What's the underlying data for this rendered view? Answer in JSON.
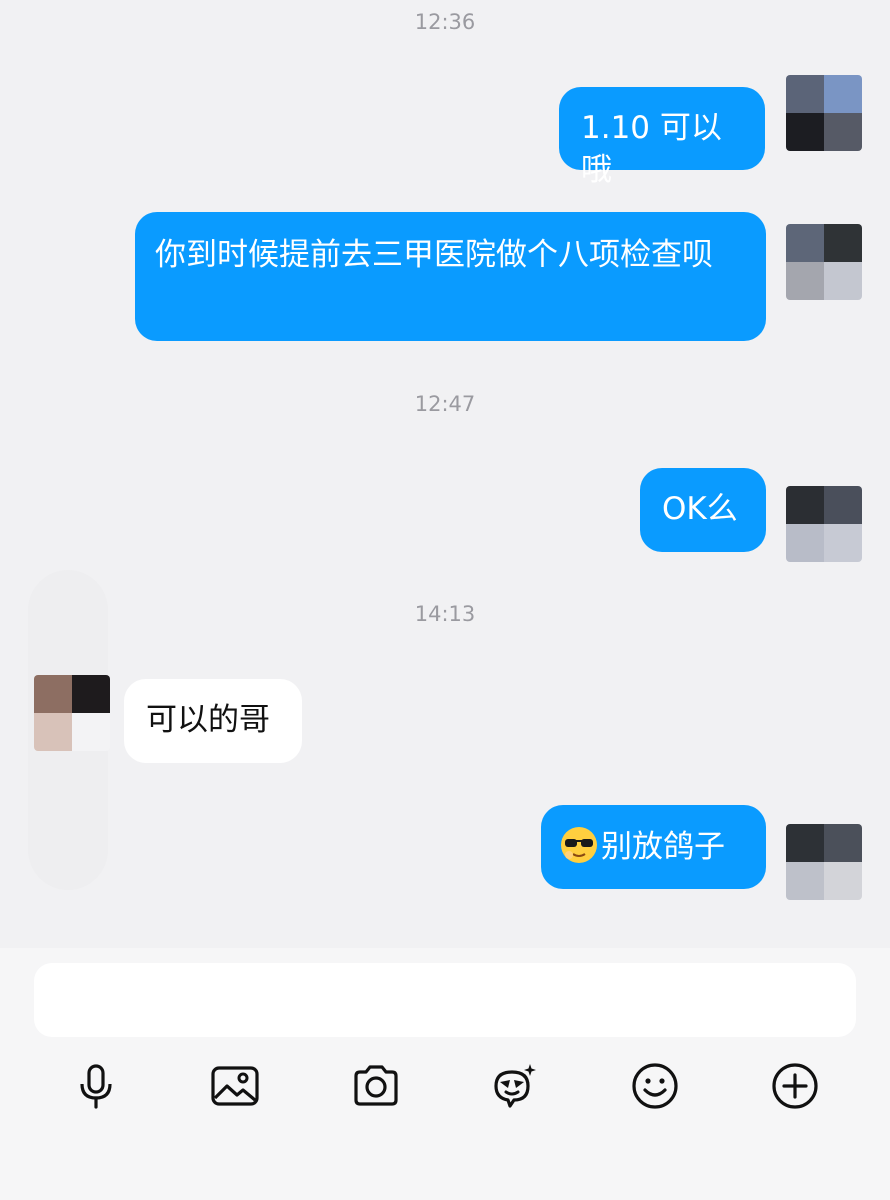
{
  "chat": {
    "timestamps": [
      "12:36",
      "12:47",
      "14:13"
    ],
    "messages": [
      {
        "direction": "outgoing",
        "text": "1.10 可以哦"
      },
      {
        "direction": "outgoing",
        "text": "你到时候提前去三甲医院做个八项检查呗"
      },
      {
        "direction": "outgoing",
        "text": "OK么"
      },
      {
        "direction": "incoming",
        "text": "可以的哥"
      },
      {
        "direction": "outgoing",
        "emoji": "sunglasses-face",
        "text": "别放鸽子"
      }
    ]
  },
  "composer": {
    "value": "",
    "placeholder": ""
  },
  "toolbar": [
    {
      "icon": "microphone-icon"
    },
    {
      "icon": "image-icon"
    },
    {
      "icon": "camera-icon"
    },
    {
      "icon": "sticker-icon"
    },
    {
      "icon": "smiley-icon"
    },
    {
      "icon": "plus-icon"
    }
  ],
  "colors": {
    "outgoing_bubble": "#0a9bff",
    "incoming_bubble": "#ffffff",
    "background": "#f1f1f3",
    "timestamp": "#9a9aa0"
  }
}
